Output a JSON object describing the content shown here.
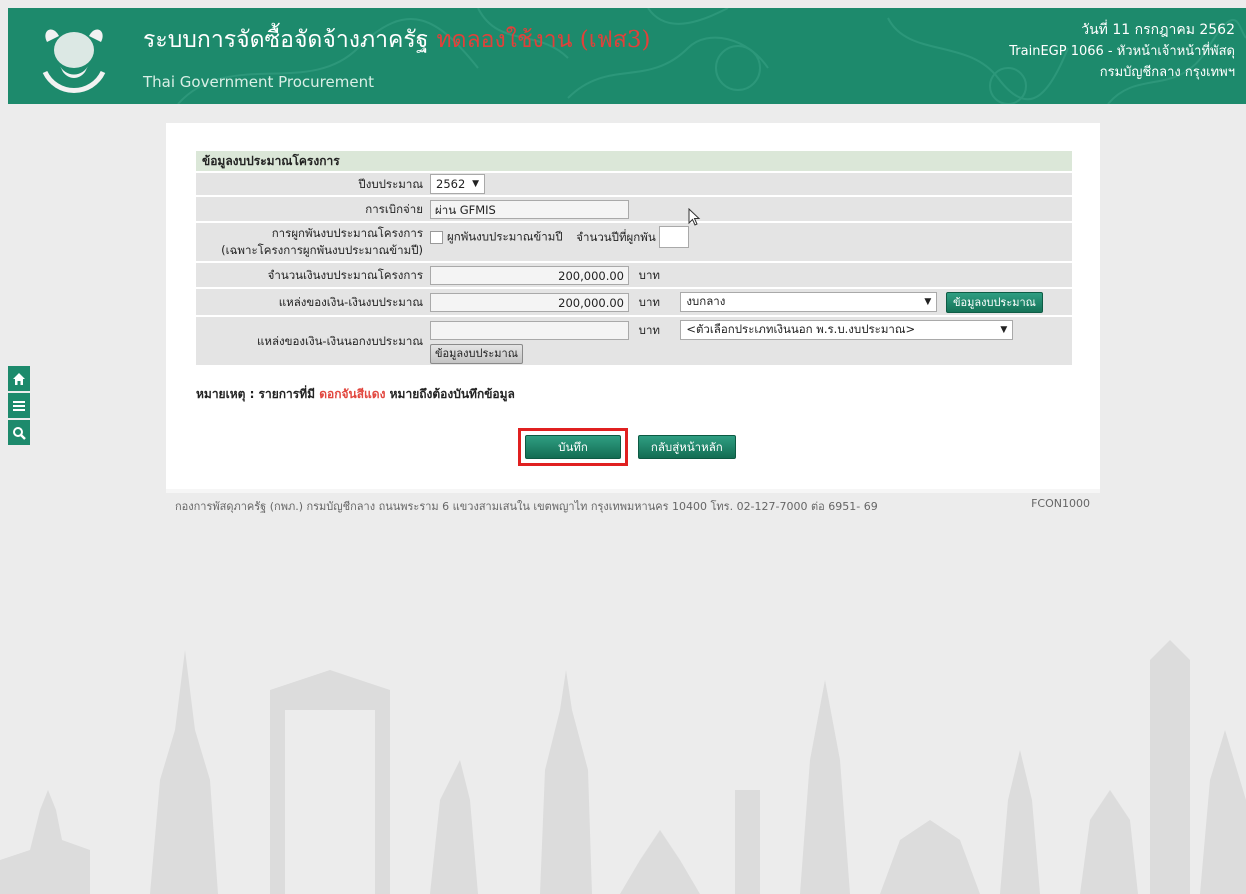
{
  "header": {
    "title": "ระบบการจัดซื้อจัดจ้างภาครัฐ",
    "trial_label": "ทดลองใช้งาน (เฟส3)",
    "subtitle": "Thai Government Procurement",
    "date": "วันที่ 11 กรกฎาคม 2562",
    "user": "TrainEGP 1066 - หัวหน้าเจ้าหน้าที่พัสดุ",
    "department": "กรมบัญชีกลาง กรุงเทพฯ",
    "logo_icon": "garuda-logo-icon"
  },
  "sidenav": {
    "items": [
      {
        "icon": "home-icon"
      },
      {
        "icon": "menu-icon"
      },
      {
        "icon": "search-icon"
      }
    ]
  },
  "form": {
    "section_title": "ข้อมูลงบประมาณโครงการ",
    "fiscal_year": {
      "label": "ปีงบประมาณ",
      "value": "2562"
    },
    "disbursement": {
      "label": "การเบิกจ่าย",
      "value": "ผ่าน GFMIS"
    },
    "commitment": {
      "label": "การผูกพันงบประมาณโครงการ",
      "sublabel": "(เฉพาะโครงการผูกพันงบประมาณข้ามปี)",
      "checkbox_label": "ผูกพันงบประมาณข้ามปี",
      "checked": false,
      "years_label": "จำนวนปีที่ผูกพัน",
      "years_value": ""
    },
    "project_budget": {
      "label": "จำนวนเงินงบประมาณโครงการ",
      "value": "200,000.00",
      "unit": "บาท"
    },
    "budget_source": {
      "label": "แหล่งของเงิน-เงินงบประมาณ",
      "value": "200,000.00",
      "unit": "บาท",
      "select_value": "งบกลาง",
      "button_label": "ข้อมูลงบประมาณ"
    },
    "offbudget_source": {
      "label": "แหล่งของเงิน-เงินนอกงบประมาณ",
      "value": "",
      "unit": "บาท",
      "select_value": "<ตัวเลือกประเภทเงินนอก พ.ร.บ.งบประมาณ>",
      "button_label": "ข้อมูลงบประมาณ"
    }
  },
  "note": {
    "prefix": "หมายเหตุ : รายการที่มี",
    "highlight": "ดอกจันสีแดง",
    "suffix": "หมายถึงต้องบันทึกข้อมูล"
  },
  "actions": {
    "save_label": "บันทึก",
    "back_label": "กลับสู่หน้าหลัก"
  },
  "footer": {
    "text": "กองการพัสดุภาครัฐ (กพภ.) กรมบัญชีกลาง ถนนพระราม 6 แขวงสามเสนใน เขตพญาไท กรุงเทพมหานคร 10400 โทร. 02-127-7000 ต่อ 6951- 69",
    "page_code": "FCON1000"
  },
  "colors": {
    "header_green": "#1d8a6c",
    "trial_red": "#e0413a",
    "highlight_box": "#e02020",
    "section_bg": "#dbe7d8"
  }
}
